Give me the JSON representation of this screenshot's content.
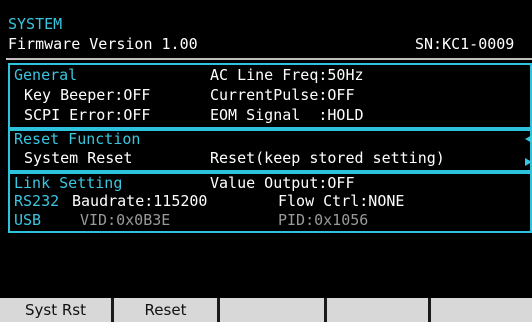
{
  "header": {
    "title": "SYSTEM",
    "firmware": "Firmware Version 1.00",
    "serial": "SN:KC1-0009"
  },
  "general": {
    "heading": "General",
    "ac_line_freq": "AC Line Freq:50Hz",
    "key_beeper": "Key Beeper:OFF",
    "current_pulse": "CurrentPulse:OFF",
    "scpi_error": "SCPI Error:OFF",
    "eom_signal": "EOM Signal  :HOLD"
  },
  "reset_function": {
    "heading": "Reset Function",
    "system_reset_label": "System Reset",
    "system_reset_value": "Reset(keep stored setting)"
  },
  "link_setting": {
    "heading": "Link Setting",
    "value_output": "Value Output:OFF",
    "rs232_label": "RS232",
    "baudrate": "Baudrate:115200",
    "flow_ctrl": "Flow Ctrl:NONE",
    "usb_label": "USB",
    "vid": "VID:0x0B3E",
    "pid": "PID:0x1056"
  },
  "softkeys": [
    "Syst Rst",
    "Reset",
    "",
    "",
    "",
    ""
  ],
  "colors": {
    "accent": "#39c6df",
    "muted": "#9a9a9a",
    "background": "#000000",
    "softkey": "#d8d8d8"
  }
}
